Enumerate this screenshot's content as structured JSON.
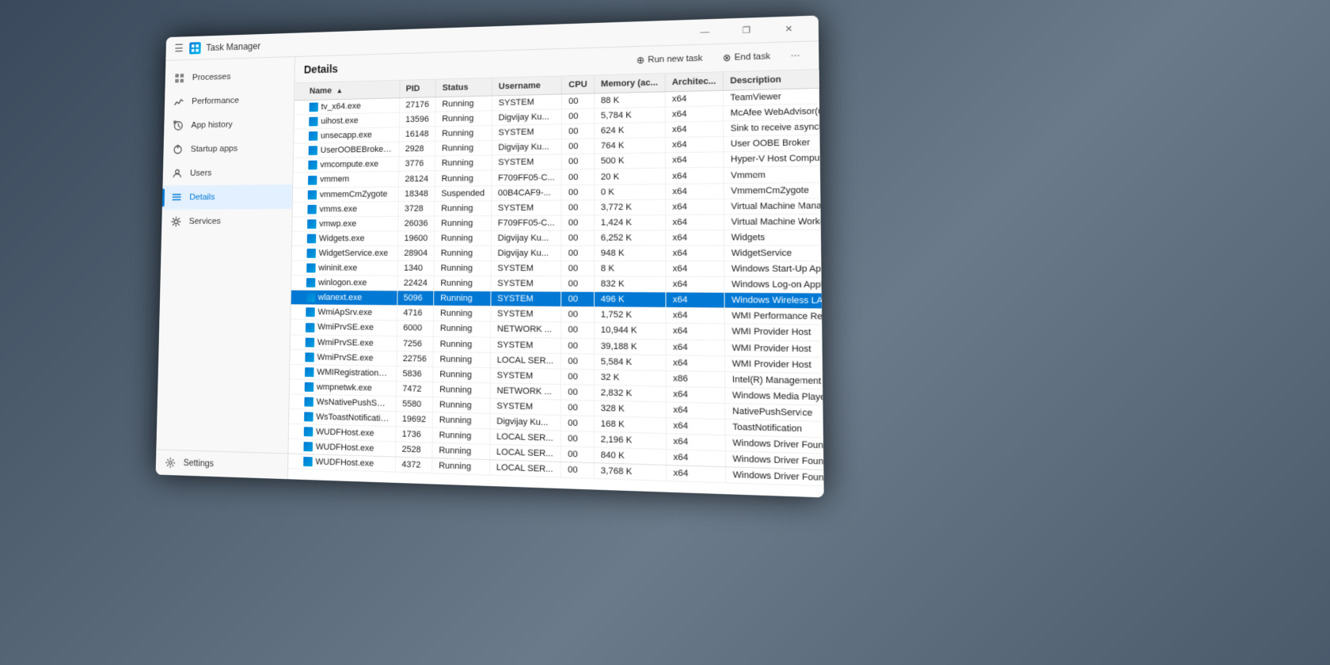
{
  "window": {
    "title": "Task Manager",
    "controls": {
      "minimize": "—",
      "maximize": "❐",
      "close": "✕"
    }
  },
  "toolbar": {
    "title": "Details",
    "run_task_label": "Run new task",
    "end_task_label": "End task",
    "more_icon": "···"
  },
  "sidebar": {
    "items": [
      {
        "id": "processes",
        "label": "Processes",
        "icon": "⊞"
      },
      {
        "id": "performance",
        "label": "Performance",
        "icon": "📈"
      },
      {
        "id": "app-history",
        "label": "App history",
        "icon": "🕐"
      },
      {
        "id": "startup-apps",
        "label": "Startup apps",
        "icon": "🚀"
      },
      {
        "id": "users",
        "label": "Users",
        "icon": "👤"
      },
      {
        "id": "details",
        "label": "Details",
        "icon": "≡",
        "active": true
      },
      {
        "id": "services",
        "label": "Services",
        "icon": "⚙"
      }
    ],
    "settings": {
      "label": "Settings",
      "icon": "⚙"
    }
  },
  "table": {
    "columns": [
      {
        "id": "name",
        "label": "Name",
        "sort": "asc"
      },
      {
        "id": "pid",
        "label": "PID"
      },
      {
        "id": "status",
        "label": "Status"
      },
      {
        "id": "username",
        "label": "Username"
      },
      {
        "id": "cpu",
        "label": "CPU"
      },
      {
        "id": "memory",
        "label": "Memory (ac..."
      },
      {
        "id": "architecture",
        "label": "Architec..."
      },
      {
        "id": "description",
        "label": "Description"
      }
    ],
    "rows": [
      {
        "name": "tv_x64.exe",
        "pid": "27176",
        "status": "Running",
        "username": "SYSTEM",
        "cpu": "00",
        "memory": "88 K",
        "arch": "x64",
        "desc": "TeamViewer"
      },
      {
        "name": "uihost.exe",
        "pid": "13596",
        "status": "Running",
        "username": "Digvijay Ku...",
        "cpu": "00",
        "memory": "5,784 K",
        "arch": "x64",
        "desc": "McAfee WebAdvisor(us..."
      },
      {
        "name": "unsecapp.exe",
        "pid": "16148",
        "status": "Running",
        "username": "SYSTEM",
        "cpu": "00",
        "memory": "624 K",
        "arch": "x64",
        "desc": "Sink to receive asynchr..."
      },
      {
        "name": "UserOOBEBroker.exe",
        "pid": "2928",
        "status": "Running",
        "username": "Digvijay Ku...",
        "cpu": "00",
        "memory": "764 K",
        "arch": "x64",
        "desc": "User OOBE Broker"
      },
      {
        "name": "vmcompute.exe",
        "pid": "3776",
        "status": "Running",
        "username": "SYSTEM",
        "cpu": "00",
        "memory": "500 K",
        "arch": "x64",
        "desc": "Hyper-V Host Compute..."
      },
      {
        "name": "vmmem",
        "pid": "28124",
        "status": "Running",
        "username": "F709FF05-C...",
        "cpu": "00",
        "memory": "20 K",
        "arch": "x64",
        "desc": "Vmmem"
      },
      {
        "name": "vmmemCmZygote",
        "pid": "18348",
        "status": "Suspended",
        "username": "00B4CAF9-...",
        "cpu": "00",
        "memory": "0 K",
        "arch": "x64",
        "desc": "VmmemCmZygote"
      },
      {
        "name": "vmms.exe",
        "pid": "3728",
        "status": "Running",
        "username": "SYSTEM",
        "cpu": "00",
        "memory": "3,772 K",
        "arch": "x64",
        "desc": "Virtual Machine Manag..."
      },
      {
        "name": "vmwp.exe",
        "pid": "26036",
        "status": "Running",
        "username": "F709FF05-C...",
        "cpu": "00",
        "memory": "1,424 K",
        "arch": "x64",
        "desc": "Virtual Machine Worker..."
      },
      {
        "name": "Widgets.exe",
        "pid": "19600",
        "status": "Running",
        "username": "Digvijay Ku...",
        "cpu": "00",
        "memory": "6,252 K",
        "arch": "x64",
        "desc": "Widgets"
      },
      {
        "name": "WidgetService.exe",
        "pid": "28904",
        "status": "Running",
        "username": "Digvijay Ku...",
        "cpu": "00",
        "memory": "948 K",
        "arch": "x64",
        "desc": "WidgetService"
      },
      {
        "name": "wininit.exe",
        "pid": "1340",
        "status": "Running",
        "username": "SYSTEM",
        "cpu": "00",
        "memory": "8 K",
        "arch": "x64",
        "desc": "Windows Start-Up Appli..."
      },
      {
        "name": "winlogon.exe",
        "pid": "22424",
        "status": "Running",
        "username": "SYSTEM",
        "cpu": "00",
        "memory": "832 K",
        "arch": "x64",
        "desc": "Windows Log-on Appli..."
      },
      {
        "name": "wlanext.exe",
        "pid": "5096",
        "status": "Running",
        "username": "SYSTEM",
        "cpu": "00",
        "memory": "496 K",
        "arch": "x64",
        "desc": "Windows Wireless LAN ...",
        "selected": true
      },
      {
        "name": "WmiApSrv.exe",
        "pid": "4716",
        "status": "Running",
        "username": "SYSTEM",
        "cpu": "00",
        "memory": "1,752 K",
        "arch": "x64",
        "desc": "WMI Performance Reve..."
      },
      {
        "name": "WmiPrvSE.exe",
        "pid": "6000",
        "status": "Running",
        "username": "NETWORK ...",
        "cpu": "00",
        "memory": "10,944 K",
        "arch": "x64",
        "desc": "WMI Provider Host"
      },
      {
        "name": "WmiPrvSE.exe",
        "pid": "7256",
        "status": "Running",
        "username": "SYSTEM",
        "cpu": "00",
        "memory": "39,188 K",
        "arch": "x64",
        "desc": "WMI Provider Host"
      },
      {
        "name": "WmiPrvSE.exe",
        "pid": "22756",
        "status": "Running",
        "username": "LOCAL SER...",
        "cpu": "00",
        "memory": "5,584 K",
        "arch": "x64",
        "desc": "WMI Provider Host"
      },
      {
        "name": "WMIRegistrationServ...",
        "pid": "5836",
        "status": "Running",
        "username": "SYSTEM",
        "cpu": "00",
        "memory": "32 K",
        "arch": "x86",
        "desc": "Intel(R) Management E..."
      },
      {
        "name": "wmpnetwk.exe",
        "pid": "7472",
        "status": "Running",
        "username": "NETWORK ...",
        "cpu": "00",
        "memory": "2,832 K",
        "arch": "x64",
        "desc": "Windows Media Player ..."
      },
      {
        "name": "WsNativePushService...",
        "pid": "5580",
        "status": "Running",
        "username": "SYSTEM",
        "cpu": "00",
        "memory": "328 K",
        "arch": "x64",
        "desc": "NativePushService"
      },
      {
        "name": "WsToastNotification...",
        "pid": "19692",
        "status": "Running",
        "username": "Digvijay Ku...",
        "cpu": "00",
        "memory": "168 K",
        "arch": "x64",
        "desc": "ToastNotification"
      },
      {
        "name": "WUDFHost.exe",
        "pid": "1736",
        "status": "Running",
        "username": "LOCAL SER...",
        "cpu": "00",
        "memory": "2,196 K",
        "arch": "x64",
        "desc": "Windows Driver Found..."
      },
      {
        "name": "WUDFHost.exe",
        "pid": "2528",
        "status": "Running",
        "username": "LOCAL SER...",
        "cpu": "00",
        "memory": "840 K",
        "arch": "x64",
        "desc": "Windows Driver Found..."
      },
      {
        "name": "WUDFHost.exe",
        "pid": "4372",
        "status": "Running",
        "username": "LOCAL SER...",
        "cpu": "00",
        "memory": "3,768 K",
        "arch": "x64",
        "desc": "Windows Driver Found..."
      }
    ]
  }
}
